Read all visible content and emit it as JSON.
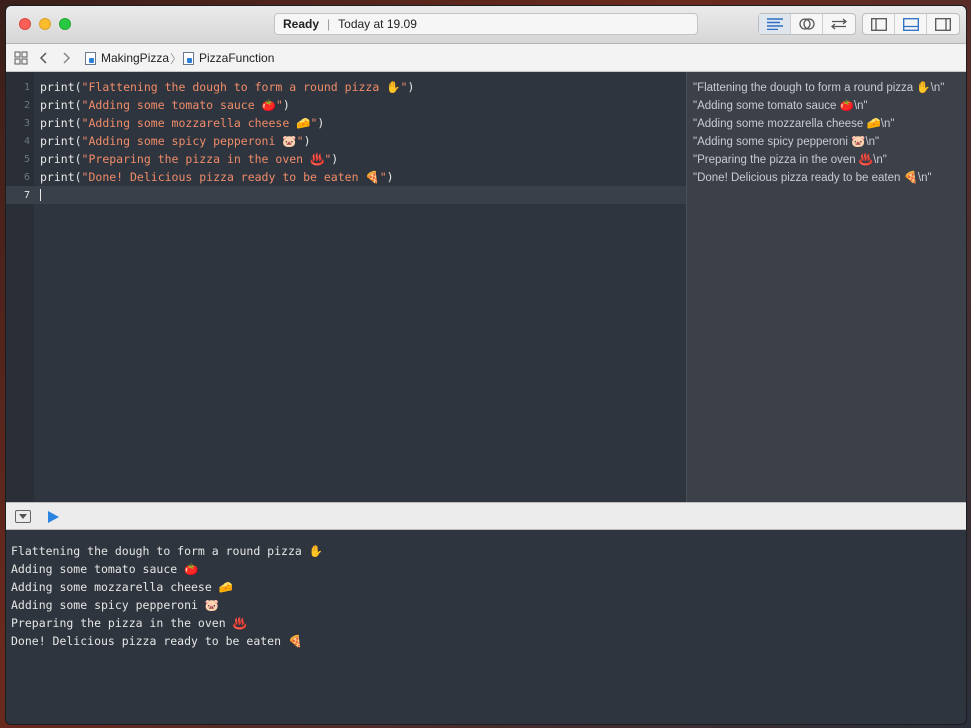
{
  "titlebar": {
    "status_state": "Ready",
    "status_time": "Today at 19.09"
  },
  "jumpbar": {
    "crumbs": [
      "MakingPizza",
      "PizzaFunction"
    ]
  },
  "editor": {
    "lines": [
      {
        "num": "1",
        "func": "print(",
        "str": "\"Flattening the dough to form a round pizza ✋\"",
        "close": ")"
      },
      {
        "num": "2",
        "func": "print(",
        "str": "\"Adding some tomato sauce 🍅\"",
        "close": ")"
      },
      {
        "num": "3",
        "func": "print(",
        "str": "\"Adding some mozzarella cheese 🧀\"",
        "close": ")"
      },
      {
        "num": "4",
        "func": "print(",
        "str": "\"Adding some spicy pepperoni 🐷\"",
        "close": ")"
      },
      {
        "num": "5",
        "func": "print(",
        "str": "\"Preparing the pizza in the oven ♨️\"",
        "close": ")"
      },
      {
        "num": "6",
        "func": "print(",
        "str": "\"Done! Delicious pizza ready to be eaten 🍕\"",
        "close": ")"
      },
      {
        "num": "7",
        "func": "",
        "str": "",
        "close": ""
      }
    ]
  },
  "results": [
    "\"Flattening the dough to form a round pizza ✋\\n\"",
    "\"Adding some tomato sauce 🍅\\n\"",
    "\"Adding some mozzarella cheese 🧀\\n\"",
    "\"Adding some spicy pepperoni 🐷\\n\"",
    "\"Preparing the pizza in the oven ♨️\\n\"",
    "\"Done! Delicious pizza ready to be eaten 🍕\\n\""
  ],
  "console": [
    "Flattening the dough to form a round pizza ✋",
    "Adding some tomato sauce 🍅",
    "Adding some mozzarella cheese 🧀",
    "Adding some spicy pepperoni 🐷",
    "Preparing the pizza in the oven ♨️",
    "Done! Delicious pizza ready to be eaten 🍕"
  ],
  "colors": {
    "editor_bg": "#2f353e",
    "string": "#f08c6a",
    "results_bg": "#3b4049",
    "accent": "#2b84e0"
  }
}
